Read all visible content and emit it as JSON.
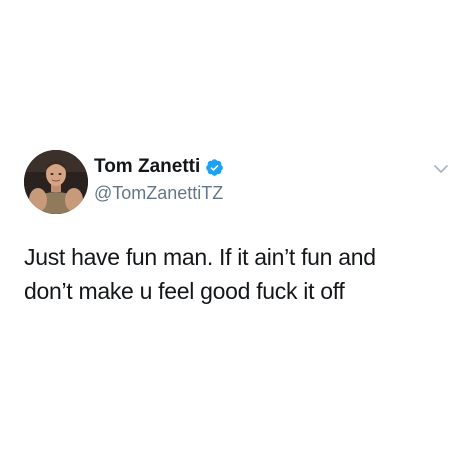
{
  "tweet": {
    "display_name": "Tom Zanetti",
    "handle": "@TomZanettiTZ",
    "verified": true,
    "verified_icon": "verified-badge-icon",
    "menu_icon": "chevron-down-icon",
    "avatar_icon": "profile-photo",
    "text_lines": [
      "Just have fun man. If it ain’t fun and",
      "don’t make u feel good fuck it off"
    ],
    "colors": {
      "name": "#14171a",
      "handle": "#657786",
      "verified": "#1da1f2",
      "chevron": "#aab8c2"
    }
  }
}
